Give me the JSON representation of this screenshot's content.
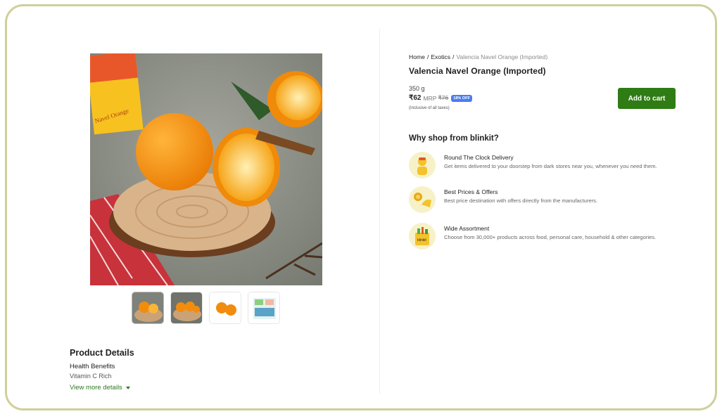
{
  "breadcrumb": {
    "home": "Home",
    "category": "Exotics",
    "current": "Valencia Navel Orange (Imported)"
  },
  "product": {
    "title": "Valencia Navel Orange (Imported)",
    "weight": "350 g",
    "price": "₹62",
    "mrp_label": "MRP",
    "mrp": "₹76",
    "discount": "18% OFF",
    "taxes": "(Inclusive of all taxes)",
    "add_to_cart": "Add to cart",
    "hero_label": "Navel Orange"
  },
  "why": {
    "title": "Why shop from blinkit?",
    "features": [
      {
        "title": "Round The Clock Delivery",
        "desc": "Get items delivered to your doorstep from dark stores near you, whenever you need them.",
        "icon": "delivery-icon"
      },
      {
        "title": "Best Prices & Offers",
        "desc": "Best price destination with offers directly from the manufacturers.",
        "icon": "offers-icon"
      },
      {
        "title": "Wide Assortment",
        "desc": "Choose from 30,000+ products across food, personal care, household & other categories.",
        "icon": "assortment-icon",
        "bag_label": "blinkit"
      }
    ]
  },
  "details": {
    "title": "Product Details",
    "label": "Health Benefits",
    "value": "Vitamin C Rich",
    "more": "View more details"
  },
  "colors": {
    "accent": "#2f7b14",
    "discount_badge": "#4a7dee",
    "frame": "#cfcf9a"
  }
}
